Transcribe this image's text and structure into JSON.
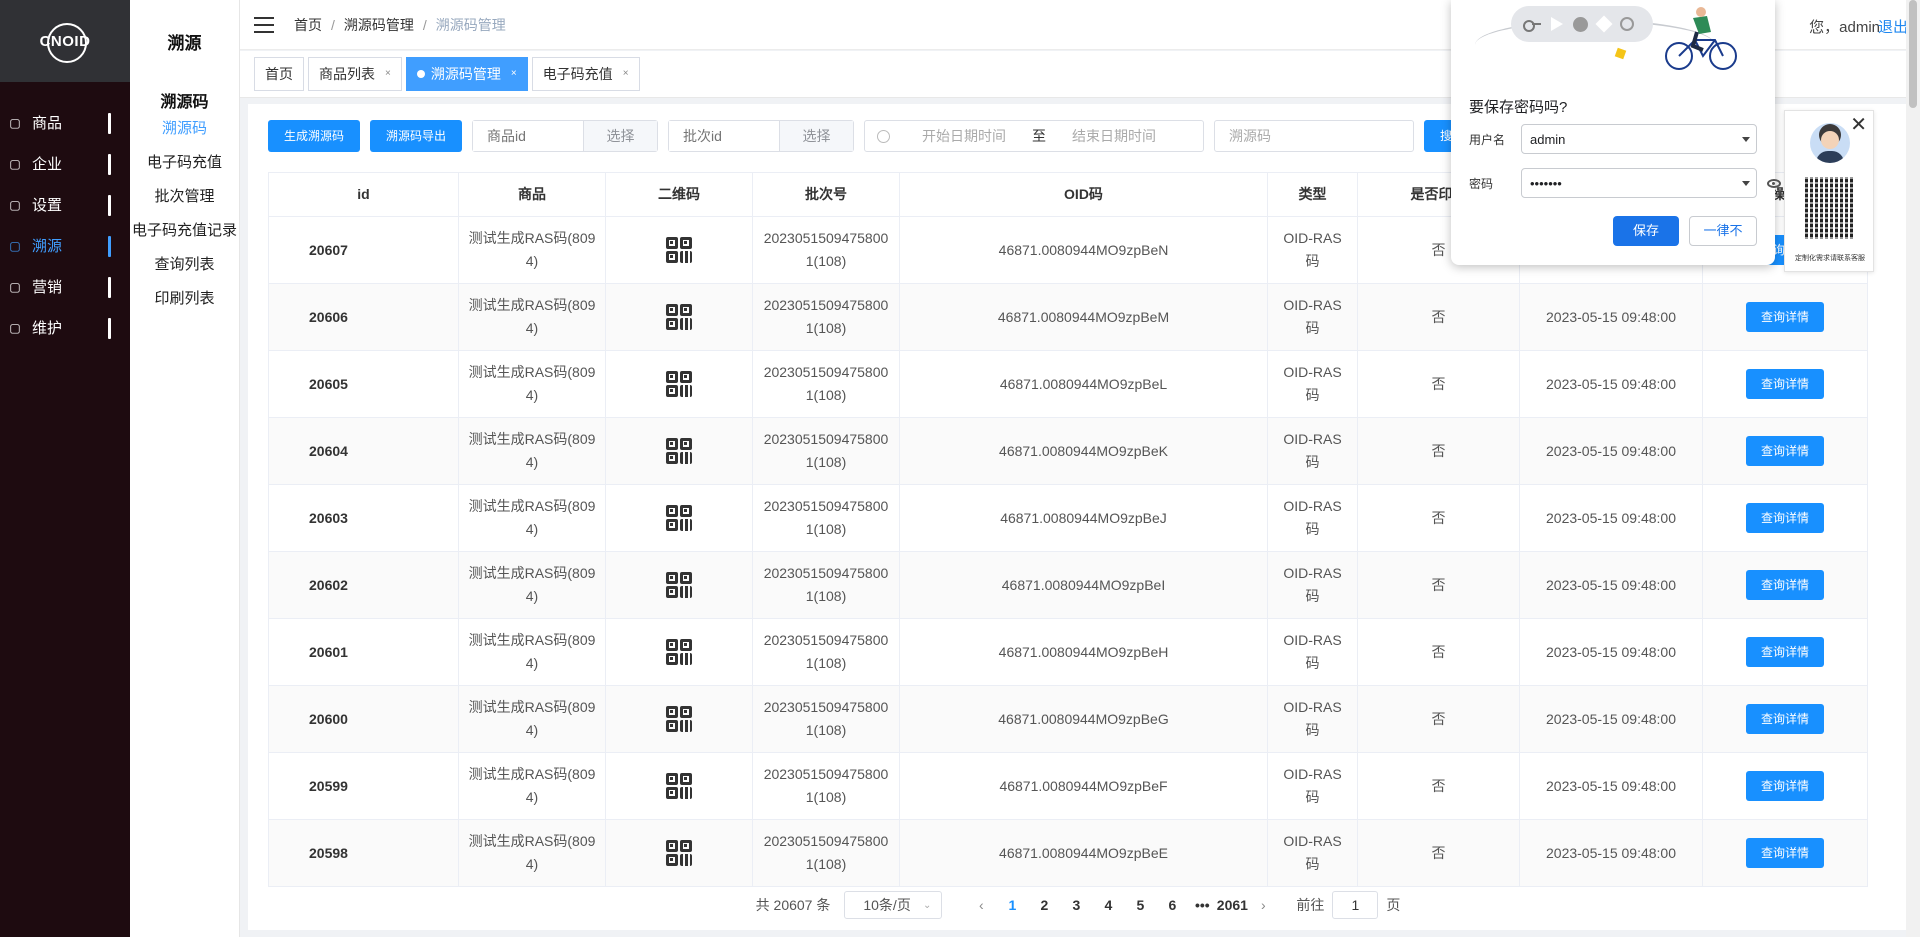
{
  "brand": {
    "logo_text": "CNOID"
  },
  "leftnav": {
    "items": [
      {
        "label": "商品",
        "icon": "bag-icon"
      },
      {
        "label": "企业",
        "icon": "building-icon"
      },
      {
        "label": "设置",
        "icon": "gear-icon"
      },
      {
        "label": "溯源",
        "icon": "trace-icon",
        "active": true
      },
      {
        "label": "营销",
        "icon": "chart-icon"
      },
      {
        "label": "维护",
        "icon": "tools-icon"
      }
    ]
  },
  "submenu": {
    "header": "溯源",
    "group_title": "溯源码",
    "items": [
      {
        "label": "溯源码",
        "active": true
      },
      {
        "label": "电子码充值"
      },
      {
        "label": "批次管理"
      },
      {
        "label": "电子码充值记录"
      },
      {
        "label": "查询列表"
      },
      {
        "label": "印刷列表"
      }
    ]
  },
  "header": {
    "breadcrumb": [
      "首页",
      "溯源码管理",
      "溯源码管理"
    ],
    "user_text": "您，admin",
    "logout": "退出"
  },
  "tabs": [
    {
      "label": "首页",
      "closable": false
    },
    {
      "label": "商品列表",
      "closable": true
    },
    {
      "label": "溯源码管理",
      "closable": true,
      "active": true
    },
    {
      "label": "电子码充值",
      "closable": true
    }
  ],
  "filters": {
    "generate_btn": "生成溯源码",
    "export_btn": "溯源码导出",
    "product_placeholder": "商品id",
    "product_pick": "选择",
    "batch_placeholder": "批次id",
    "batch_pick": "选择",
    "date_start": "开始日期时间",
    "date_to": "至",
    "date_end": "结束日期时间",
    "code_placeholder": "溯源码",
    "search_btn": "搜索"
  },
  "table": {
    "columns": [
      "id",
      "商品",
      "二维码",
      "批次号",
      "OID码",
      "类型",
      "是否印刷",
      "",
      "操作"
    ],
    "rows": [
      {
        "id": "20607",
        "product": "测试生成RAS码(8094)",
        "batch": "20230515094758001(108)",
        "oid": "46871.0080944MO9zpBeN",
        "type": "OID-RAS码",
        "printed": "否",
        "time": "",
        "action": "查询详情"
      },
      {
        "id": "20606",
        "product": "测试生成RAS码(8094)",
        "batch": "20230515094758001(108)",
        "oid": "46871.0080944MO9zpBeM",
        "type": "OID-RAS码",
        "printed": "否",
        "time": "2023-05-15 09:48:00",
        "action": "查询详情"
      },
      {
        "id": "20605",
        "product": "测试生成RAS码(8094)",
        "batch": "20230515094758001(108)",
        "oid": "46871.0080944MO9zpBeL",
        "type": "OID-RAS码",
        "printed": "否",
        "time": "2023-05-15 09:48:00",
        "action": "查询详情"
      },
      {
        "id": "20604",
        "product": "测试生成RAS码(8094)",
        "batch": "20230515094758001(108)",
        "oid": "46871.0080944MO9zpBeK",
        "type": "OID-RAS码",
        "printed": "否",
        "time": "2023-05-15 09:48:00",
        "action": "查询详情"
      },
      {
        "id": "20603",
        "product": "测试生成RAS码(8094)",
        "batch": "20230515094758001(108)",
        "oid": "46871.0080944MO9zpBeJ",
        "type": "OID-RAS码",
        "printed": "否",
        "time": "2023-05-15 09:48:00",
        "action": "查询详情"
      },
      {
        "id": "20602",
        "product": "测试生成RAS码(8094)",
        "batch": "20230515094758001(108)",
        "oid": "46871.0080944MO9zpBeI",
        "type": "OID-RAS码",
        "printed": "否",
        "time": "2023-05-15 09:48:00",
        "action": "查询详情"
      },
      {
        "id": "20601",
        "product": "测试生成RAS码(8094)",
        "batch": "20230515094758001(108)",
        "oid": "46871.0080944MO9zpBeH",
        "type": "OID-RAS码",
        "printed": "否",
        "time": "2023-05-15 09:48:00",
        "action": "查询详情"
      },
      {
        "id": "20600",
        "product": "测试生成RAS码(8094)",
        "batch": "20230515094758001(108)",
        "oid": "46871.0080944MO9zpBeG",
        "type": "OID-RAS码",
        "printed": "否",
        "time": "2023-05-15 09:48:00",
        "action": "查询详情"
      },
      {
        "id": "20599",
        "product": "测试生成RAS码(8094)",
        "batch": "20230515094758001(108)",
        "oid": "46871.0080944MO9zpBeF",
        "type": "OID-RAS码",
        "printed": "否",
        "time": "2023-05-15 09:48:00",
        "action": "查询详情"
      },
      {
        "id": "20598",
        "product": "测试生成RAS码(8094)",
        "batch": "20230515094758001(108)",
        "oid": "46871.0080944MO9zpBeE",
        "type": "OID-RAS码",
        "printed": "否",
        "time": "2023-05-15 09:48:00",
        "action": "查询详情"
      }
    ]
  },
  "pagination": {
    "total": "共 20607 条",
    "page_size": "10条/页",
    "pages": [
      "1",
      "2",
      "3",
      "4",
      "5",
      "6"
    ],
    "current": "1",
    "ellipsis": "•••",
    "last": "2061",
    "goto_label": "前往",
    "goto_value": "1",
    "goto_suffix": "页"
  },
  "save_password": {
    "title": "要保存密码吗?",
    "username_label": "用户名",
    "username_value": "admin",
    "password_label": "密码",
    "password_value": "•••••••",
    "save": "保存",
    "never": "一律不"
  },
  "qr_card": {
    "caption": "定制化需求请联系客服"
  },
  "colors": {
    "primary": "#1890ff",
    "nav_bg": "#1e0b10",
    "logo_bg": "#303135",
    "chrome_blue": "#1a73e8"
  }
}
